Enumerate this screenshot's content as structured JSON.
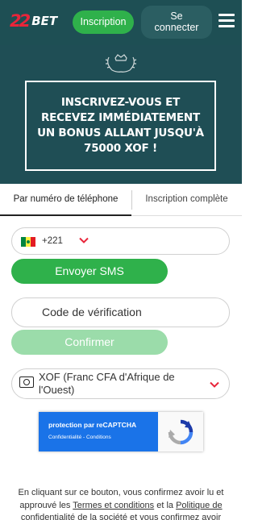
{
  "header": {
    "logo_mark": "22",
    "logo_text": "BET",
    "inscription_label": "Inscription",
    "connect_label_line1": "Se",
    "connect_label_line2": "connecter"
  },
  "banner": {
    "promo_text": "INSCRIVEZ-VOUS ET RECEVEZ IMMÉDIATEMENT UN BONUS ALLANT JUSQU'À 75000 XOF !"
  },
  "tabs": [
    {
      "label": "Par numéro de téléphone",
      "active": true
    },
    {
      "label": "Inscription complète",
      "active": false
    }
  ],
  "phone": {
    "country": "Senegal",
    "dial_code": "+221"
  },
  "sms_button": "Envoyer SMS",
  "verification": {
    "placeholder": "Code de vérification"
  },
  "confirm_button": "Confirmer",
  "currency": {
    "selected": "XOF (Franc CFA d'Afrique de l'Ouest)"
  },
  "recaptcha": {
    "title": "protection par reCAPTCHA",
    "privacy": "Confidentialité",
    "separator": " - ",
    "terms": "Conditions"
  },
  "disclaimer": {
    "text_1": "En cliquant sur ce bouton, vous confirmez avoir lu et approuvé les ",
    "link_terms": "Termes et conditions",
    "text_2": " et la ",
    "link_policy": "Politique de confidentialité de la société",
    "text_3": " et vous confirmez avoir"
  },
  "colors": {
    "header_bg": "#1e4f54",
    "banner_bg": "#1f4e55",
    "green": "#2fb14b",
    "green_disabled": "#9bdcaa",
    "chevron_red": "#e8253a",
    "recaptcha_blue": "#1a73e8"
  },
  "icons": [
    "hamburger-menu-icon",
    "laurel-crown-icon",
    "senegal-flag-icon",
    "chevron-down-icon",
    "currency-banknote-icon",
    "recaptcha-logo-icon"
  ]
}
